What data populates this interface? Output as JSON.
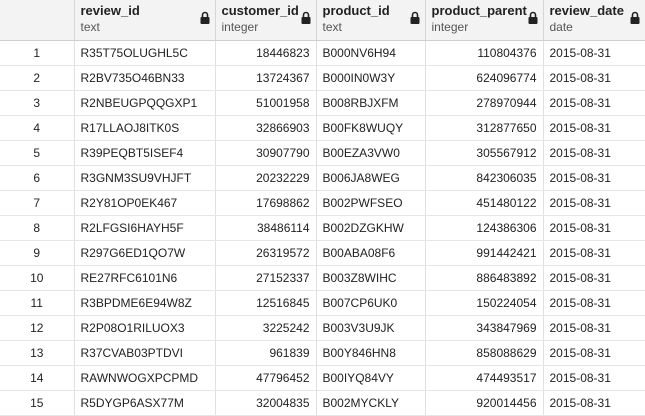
{
  "columns": [
    {
      "name": "review_id",
      "type": "text",
      "align": "txt"
    },
    {
      "name": "customer_id",
      "type": "integer",
      "align": "num"
    },
    {
      "name": "product_id",
      "type": "text",
      "align": "txt"
    },
    {
      "name": "product_parent",
      "type": "integer",
      "align": "num"
    },
    {
      "name": "review_date",
      "type": "date",
      "align": "txt"
    }
  ],
  "rows": [
    [
      "1",
      "R35T75OLUGHL5C",
      "18446823",
      "B000NV6H94",
      "110804376",
      "2015-08-31"
    ],
    [
      "2",
      "R2BV735O46BN33",
      "13724367",
      "B000IN0W3Y",
      "624096774",
      "2015-08-31"
    ],
    [
      "3",
      "R2NBEUGPQQGXP1",
      "51001958",
      "B008RBJXFM",
      "278970944",
      "2015-08-31"
    ],
    [
      "4",
      "R17LLAOJ8ITK0S",
      "32866903",
      "B00FK8WUQY",
      "312877650",
      "2015-08-31"
    ],
    [
      "5",
      "R39PEQBT5ISEF4",
      "30907790",
      "B00EZA3VW0",
      "305567912",
      "2015-08-31"
    ],
    [
      "6",
      "R3GNM3SU9VHJFT",
      "20232229",
      "B006JA8WEG",
      "842306035",
      "2015-08-31"
    ],
    [
      "7",
      "R2Y81OP0EK467",
      "17698862",
      "B002PWFSEO",
      "451480122",
      "2015-08-31"
    ],
    [
      "8",
      "R2LFGSI6HAYH5F",
      "38486114",
      "B002DZGKHW",
      "124386306",
      "2015-08-31"
    ],
    [
      "9",
      "R297G6ED1QO7W",
      "26319572",
      "B00ABA08F6",
      "991442421",
      "2015-08-31"
    ],
    [
      "10",
      "RE27RFC6101N6",
      "27152337",
      "B003Z8WIHC",
      "886483892",
      "2015-08-31"
    ],
    [
      "11",
      "R3BPDME6E94W8Z",
      "12516845",
      "B007CP6UK0",
      "150224054",
      "2015-08-31"
    ],
    [
      "12",
      "R2P08O1RILUOX3",
      "3225242",
      "B003V3U9JK",
      "343847969",
      "2015-08-31"
    ],
    [
      "13",
      "R37CVAB03PTDVI",
      "961839",
      "B00Y846HN8",
      "858088629",
      "2015-08-31"
    ],
    [
      "14",
      "RAWNWOGXPCPMD",
      "47796452",
      "B00IYQ84VY",
      "474493517",
      "2015-08-31"
    ],
    [
      "15",
      "R5DYGP6ASX77M",
      "32004835",
      "B002MYCKLY",
      "920014456",
      "2015-08-31"
    ]
  ]
}
